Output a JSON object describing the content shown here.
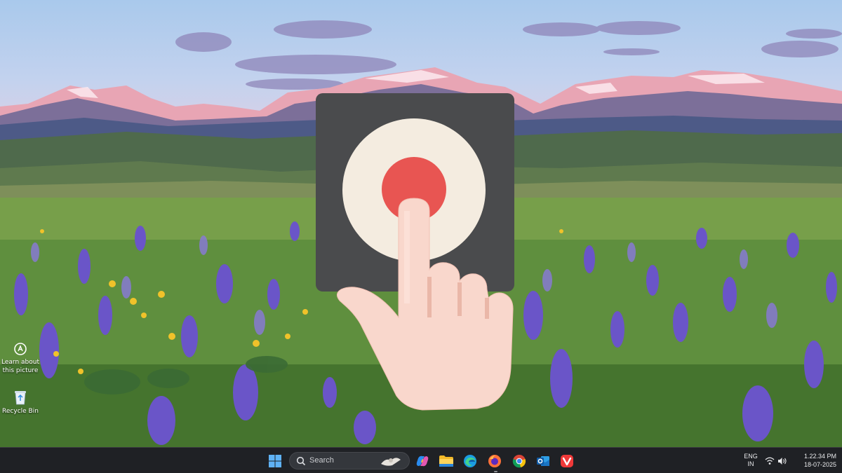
{
  "desktop": {
    "icons": [
      {
        "label_line1": "Learn about",
        "label_line2": "this picture",
        "icon": "learn-about-icon"
      },
      {
        "label_line1": "Recycle Bin",
        "icon": "recycle-bin-icon"
      }
    ]
  },
  "overlay": {
    "icon": "press-button-finger-icon",
    "colors": {
      "card": "#4a4b4d",
      "ring": "#f4ece0",
      "button": "#e85552",
      "skin": "#f9d7cc"
    }
  },
  "taskbar": {
    "start_icon": "windows-start-icon",
    "search": {
      "placeholder": "Search"
    },
    "pinned": [
      {
        "name": "copilot-icon"
      },
      {
        "name": "file-explorer-icon"
      },
      {
        "name": "edge-icon"
      },
      {
        "name": "firefox-icon"
      },
      {
        "name": "chrome-icon"
      },
      {
        "name": "outlook-icon"
      },
      {
        "name": "vivaldi-icon"
      }
    ],
    "tray": {
      "lang_top": "ENG",
      "lang_bottom": "IN",
      "time": "1.22.34 PM",
      "date": "18-07-2025"
    }
  }
}
